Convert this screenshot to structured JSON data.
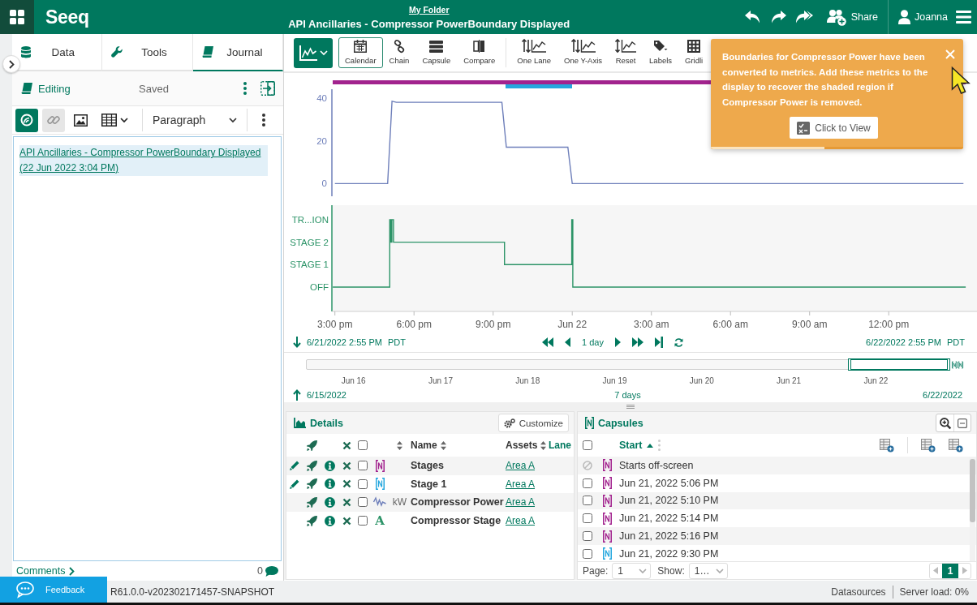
{
  "header": {
    "logo": "Seeq",
    "folder_link": "My Folder",
    "title": "API Ancillaries - Compressor PowerBoundary Displayed",
    "share_label": "Share",
    "user_name": "Joanna"
  },
  "left_panel": {
    "tabs": [
      {
        "label": "Data",
        "selected": false
      },
      {
        "label": "Tools",
        "selected": false
      },
      {
        "label": "Journal",
        "selected": true
      }
    ],
    "journal": {
      "mode": "Editing",
      "save_status": "Saved",
      "toolbar": [
        {
          "selected": true,
          "disabled": false
        },
        {
          "selected": false,
          "disabled": true
        },
        {
          "selected": false,
          "disabled": false
        },
        {
          "selected": false,
          "disabled": false
        }
      ],
      "block_format": "Paragraph",
      "link_text": "API Ancillaries - Compressor PowerBoundary Displayed (22 Jun 2022 3:04 PM)"
    },
    "comments": {
      "label": "Comments",
      "count": "0"
    }
  },
  "trend": {
    "toolbar": [
      {
        "label": "Calendar",
        "selected": true
      },
      {
        "label": "Chain",
        "selected": false
      },
      {
        "label": "Capsule",
        "selected": false
      },
      {
        "label": "Compare",
        "selected": false
      },
      {
        "label": "One Lane",
        "selected": false
      },
      {
        "label": "One Y-Axis",
        "selected": false
      },
      {
        "label": "Reset",
        "selected": false
      },
      {
        "label": "Labels",
        "selected": false
      },
      {
        "label": "Gridli",
        "selected": false
      }
    ],
    "chart_data": {
      "type": "line",
      "categories": [
        null,
        null,
        null,
        null,
        null,
        null,
        null,
        null,
        null,
        null,
        null,
        null,
        null,
        null,
        null,
        null,
        null,
        null,
        null,
        null,
        null,
        null,
        null,
        null,
        null,
        null,
        null,
        null,
        null,
        null,
        null,
        null,
        null,
        null,
        null,
        null,
        null,
        null,
        null,
        null,
        null,
        null,
        null,
        null,
        null,
        null,
        null,
        null,
        null,
        null,
        null,
        null,
        null,
        null,
        null,
        null,
        null,
        null,
        null,
        null,
        null,
        null,
        null,
        null,
        null,
        null,
        null,
        null,
        null,
        null,
        null,
        null,
        null,
        null,
        null,
        null,
        null,
        null,
        null,
        null,
        null,
        null,
        null,
        null,
        null,
        null,
        null,
        null,
        null,
        null,
        null,
        null,
        null,
        null,
        null,
        null,
        null,
        null,
        null,
        null,
        null,
        null,
        null,
        null,
        null,
        null,
        null,
        null,
        null,
        null,
        null,
        null,
        null,
        null,
        null,
        null,
        null,
        null,
        null,
        null,
        null,
        null,
        null,
        null,
        null,
        null,
        null,
        null,
        null,
        null,
        null,
        null,
        null,
        null,
        null,
        null,
        null,
        null,
        null,
        null,
        null,
        null,
        null,
        null
      ],
      "series": [
        {
          "color": "#6e7fba",
          "values": [
            0,
            0,
            0,
            0,
            0,
            0,
            0,
            0,
            0,
            0,
            0,
            0,
            0,
            38.5,
            38,
            38,
            38,
            38,
            38,
            38,
            38,
            38,
            38,
            38,
            38,
            38,
            38,
            38,
            38,
            38,
            38,
            38,
            38,
            38,
            38,
            38,
            38,
            38,
            38,
            17,
            17,
            17,
            17,
            17,
            17,
            17,
            17,
            17,
            17,
            17,
            17,
            17,
            17,
            17,
            0,
            0,
            0,
            0,
            0,
            0,
            0,
            0,
            0,
            0,
            0,
            0,
            0,
            0,
            0,
            0,
            0,
            0,
            0,
            0,
            0,
            0,
            0,
            0,
            0,
            0,
            0,
            0,
            0,
            0,
            0,
            0,
            0,
            0,
            0,
            0,
            0,
            0,
            0,
            0,
            0,
            0,
            0,
            0,
            0,
            0,
            0,
            0,
            0,
            0,
            0,
            0,
            0,
            0,
            0,
            0,
            0,
            0,
            0,
            0,
            0,
            0,
            0,
            0,
            0,
            0,
            0,
            0,
            0,
            0,
            0,
            0,
            0,
            0,
            0,
            0,
            0,
            0,
            0,
            0,
            0,
            0,
            0,
            0,
            0,
            0,
            0,
            0,
            0,
            0
          ]
        }
      ],
      "ylim": [
        -5.9,
        44.1
      ],
      "yticks": [
        0,
        20,
        40
      ]
    },
    "state_lane": {
      "labels": [
        "TR...ION",
        "STAGE 2",
        "STAGE 1",
        "OFF"
      ]
    },
    "time_axis": {
      "labels": [
        "3:00 pm",
        "6:00 pm",
        "9:00 pm",
        "Jun 22",
        "3:00 am",
        "6:00 am",
        "9:00 am",
        "12:00 pm"
      ]
    },
    "navigation": {
      "start": "6/21/2022 2:55 PM",
      "start_zone": "PDT",
      "step": "1 day",
      "end": "6/22/2022 2:55 PM",
      "end_zone": "PDT"
    },
    "overview": {
      "date_labels": [
        "Jun 16",
        "Jun 17",
        "Jun 18",
        "Jun 19",
        "Jun 20",
        "Jun 21",
        "Jun 22"
      ],
      "start": "6/15/2022",
      "span": "7 days",
      "end": "6/22/2022"
    }
  },
  "notification": {
    "message": "Boundaries for Compressor Power have been converted to metrics. Add these metrics to the display to recover the shaded region if Compressor Power is removed.",
    "button": "Click to View",
    "timer": {
      "level": 0.45
    }
  },
  "details": {
    "title": "Details",
    "customize_button": "Customize",
    "select_all": {
      "checked": false
    },
    "columns": [
      "Name",
      "Assets",
      "Lane"
    ],
    "rows": [
      {
        "kind": "condition",
        "editable": true,
        "checked": false,
        "color": "#a2238e",
        "name": "Stages",
        "asset": "Area A"
      },
      {
        "kind": "condition",
        "editable": true,
        "checked": false,
        "color": "#25a7de",
        "name": "Stage 1",
        "asset": "Area A"
      },
      {
        "kind": "signal",
        "editable": false,
        "checked": false,
        "color": "#6e7fba",
        "unit": "kW",
        "name": "Compressor Power",
        "asset": "Area A"
      },
      {
        "kind": "string",
        "editable": false,
        "checked": false,
        "color": "#2d9468",
        "glyph": "A",
        "name": "Compressor Stage",
        "asset": "Area A"
      }
    ]
  },
  "capsules": {
    "title": "Capsules",
    "select_all": {
      "checked": false
    },
    "column": "Start",
    "sort_ascending": true,
    "rows": [
      {
        "start": "Starts off-screen",
        "color": "#a2238e",
        "selectable": false,
        "checked": false
      },
      {
        "start": "Jun 21, 2022 5:06 PM",
        "color": "#a2238e",
        "selectable": true,
        "checked": false
      },
      {
        "start": "Jun 21, 2022 5:10 PM",
        "color": "#a2238e",
        "selectable": true,
        "checked": false
      },
      {
        "start": "Jun 21, 2022 5:14 PM",
        "color": "#a2238e",
        "selectable": true,
        "checked": false
      },
      {
        "start": "Jun 21, 2022 5:16 PM",
        "color": "#a2238e",
        "selectable": true,
        "checked": false
      },
      {
        "start": "Jun 21, 2022 9:30 PM",
        "color": "#25a7de",
        "selectable": true,
        "checked": false
      }
    ],
    "footer": {
      "page_label": "Page:",
      "page": "1",
      "show_label": "Show:",
      "show": "1…",
      "current_page": "1"
    }
  },
  "status_bar": {
    "feedback": "Feedback",
    "version": "R61.0.0-v202302171457-SNAPSHOT",
    "datasources": "Datasources",
    "server_load": "Server load: 0%"
  }
}
